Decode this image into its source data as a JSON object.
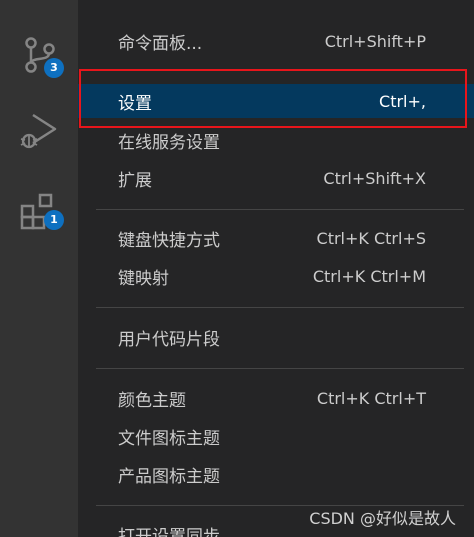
{
  "activity_bar": {
    "source_control_badge": "3",
    "extensions_badge": "1",
    "icons": [
      "source-control-icon",
      "run-debug-icon",
      "extensions-icon"
    ]
  },
  "menu": {
    "items": [
      {
        "label": "命令面板...",
        "shortcut": "Ctrl+Shift+P"
      },
      {
        "label": "设置",
        "shortcut": "Ctrl+,"
      },
      {
        "label": "在线服务设置",
        "shortcut": ""
      },
      {
        "label": "扩展",
        "shortcut": "Ctrl+Shift+X"
      },
      {
        "label": "键盘快捷方式",
        "shortcut": "Ctrl+K Ctrl+S"
      },
      {
        "label": "键映射",
        "shortcut": "Ctrl+K Ctrl+M"
      },
      {
        "label": "用户代码片段",
        "shortcut": ""
      },
      {
        "label": "颜色主题",
        "shortcut": "Ctrl+K Ctrl+T"
      },
      {
        "label": "文件图标主题",
        "shortcut": ""
      },
      {
        "label": "产品图标主题",
        "shortcut": ""
      },
      {
        "label": "打开设置同步...",
        "shortcut": ""
      }
    ]
  },
  "colors": {
    "activity_bar_bg": "#333333",
    "menu_bg": "#252526",
    "selected_bg": "#04395e",
    "badge_bg": "#0e70c0",
    "highlight_border": "#e8151b"
  },
  "watermark": "CSDN @好似是故人"
}
